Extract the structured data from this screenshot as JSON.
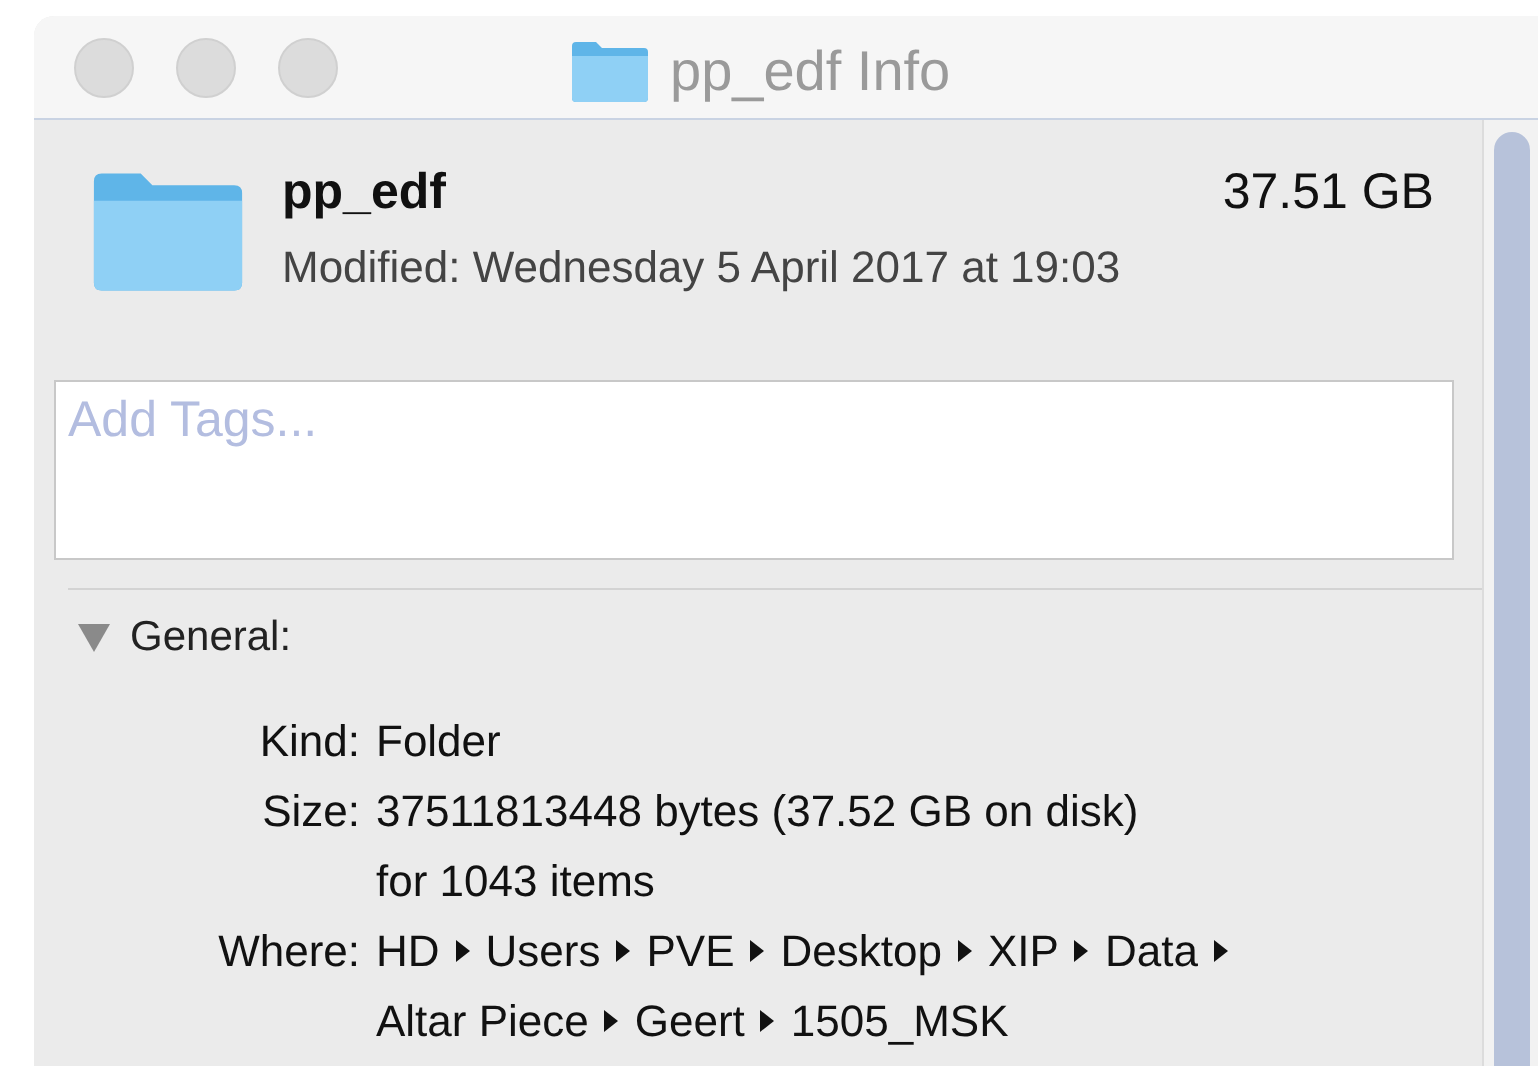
{
  "window": {
    "title": "pp_edf Info"
  },
  "header": {
    "name": "pp_edf",
    "size": "37.51 GB",
    "modified": "Modified: Wednesday 5 April 2017 at 19:03"
  },
  "tags": {
    "placeholder": "Add Tags..."
  },
  "general": {
    "title": "General:",
    "expanded": true,
    "rows": [
      {
        "kind": "text",
        "label": "Kind:",
        "lines": [
          "Folder"
        ]
      },
      {
        "kind": "text",
        "label": "Size:",
        "lines": [
          "37511813448 bytes (37.52 GB on disk)",
          "for 1043 items"
        ]
      },
      {
        "kind": "path",
        "label": "Where:",
        "segments": [
          "HD",
          "Users",
          "PVE",
          "Desktop",
          "XIP",
          "Data",
          "Altar Piece",
          "Geert",
          "1505_MSK"
        ]
      }
    ]
  }
}
